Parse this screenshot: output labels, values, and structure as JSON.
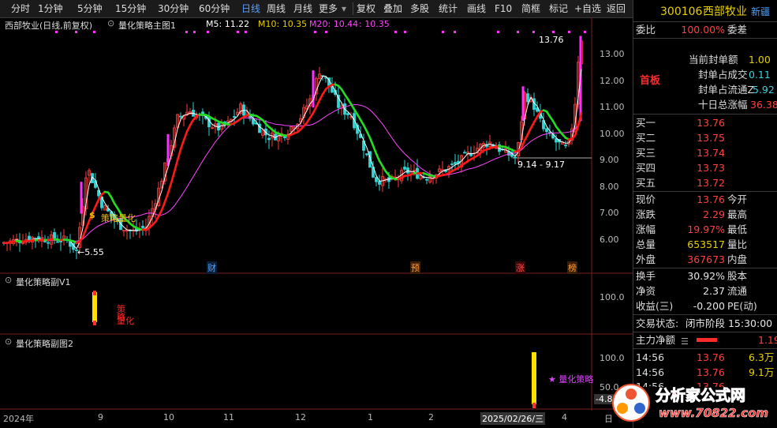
{
  "toolbar": {
    "periods": [
      "分时",
      "1分钟",
      "5分钟",
      "15分钟",
      "30分钟",
      "60分钟",
      "日线",
      "周线",
      "月线",
      "更多"
    ],
    "active_period": "日线",
    "tools": [
      "复权",
      "叠加",
      "多股",
      "统计",
      "画线",
      "F10",
      "简框",
      "标记",
      "+自选",
      "返回"
    ]
  },
  "chart": {
    "stock_label": "西部牧业(日线,前复权)",
    "indicator": "量化策略主图1",
    "ma5": "M5: 11.22",
    "ma10": "M10: 10.35",
    "ma20": "M20: 10.44",
    "ma_extra": ": 10.35",
    "high_annotation": "13.76",
    "low_annotation": "←5.55",
    "range_annotation": "9.14 - 9.17",
    "signal_label": "策略量化",
    "event_markers": [
      "财",
      "预",
      "涨",
      "榜"
    ],
    "price_axis": [
      "13.00",
      "12.00",
      "11.00",
      "10.00",
      "9.00",
      "8.00",
      "7.00",
      "6.00"
    ],
    "sub1_title": "量化策略副V1",
    "sub1_axis": "100.0",
    "sub1_text": [
      "策",
      "略",
      "量化"
    ],
    "sub2_title": "量化策略副图2",
    "sub2_axis": "100.0",
    "sub2_axis2": "50.0",
    "sub2_neg": "-4.8",
    "sub2_label": "★ 量化策略",
    "dates": [
      "2024年",
      "9",
      "10",
      "11",
      "12",
      "1",
      "2",
      "2025/02/26/三",
      "4",
      "日"
    ],
    "colors": {
      "up": "#ff3b3b",
      "down": "#2ed6d6",
      "ma5": "#ffffff",
      "ma10": "#e8d000",
      "ma20": "#ff44ff",
      "trend_red": "#ff1a1a",
      "trend_green": "#22dd22"
    }
  },
  "panel": {
    "code": "300106",
    "name": "西部牧业",
    "tag": "新疆",
    "weibi_label": "委比",
    "weibi_value": "100.00%",
    "weicha_label": "委差",
    "board_label": "首板",
    "seal_rows": [
      {
        "k": "当前封单额",
        "v": "1.00"
      },
      {
        "k": "封单占成交",
        "v": "0.11"
      },
      {
        "k": "封单占流通Z",
        "v": "5.92"
      },
      {
        "k": "十日总涨幅",
        "v": "36.38"
      }
    ],
    "bids": [
      {
        "k": "买一",
        "v": "13.76"
      },
      {
        "k": "买二",
        "v": "13.75"
      },
      {
        "k": "买三",
        "v": "13.74"
      },
      {
        "k": "买四",
        "v": "13.73"
      },
      {
        "k": "买五",
        "v": "13.72"
      }
    ],
    "quote": [
      {
        "k": "现价",
        "v": "13.76",
        "k2": "今开"
      },
      {
        "k": "涨跌",
        "v": "2.29",
        "k2": "最高"
      },
      {
        "k": "涨幅",
        "v": "19.97%",
        "k2": "最低"
      },
      {
        "k": "总量",
        "v": "653517",
        "k2": "量比"
      },
      {
        "k": "外盘",
        "v": "367673",
        "k2": "内盘"
      }
    ],
    "stats": [
      {
        "k": "换手",
        "v": "30.92%",
        "k2": "股本"
      },
      {
        "k": "净资",
        "v": "2.37",
        "k2": "流通"
      },
      {
        "k": "收益(三)",
        "v": "-0.200",
        "k2": "PE(动)"
      }
    ],
    "status_label": "交易状态:",
    "status_value": "闭市阶段 15:30:00",
    "net_label": "主力净额",
    "net_value": "1.19",
    "ticks": [
      {
        "t": "14:56",
        "p": "13.76",
        "v": "6.3万"
      },
      {
        "t": "14:56",
        "p": "13.76",
        "v": "9.1万"
      },
      {
        "t": "14:56",
        "p": "13.76",
        "v": ""
      }
    ],
    "watermark": "分析家公式网",
    "watermark_url": "www.70822.com"
  }
}
